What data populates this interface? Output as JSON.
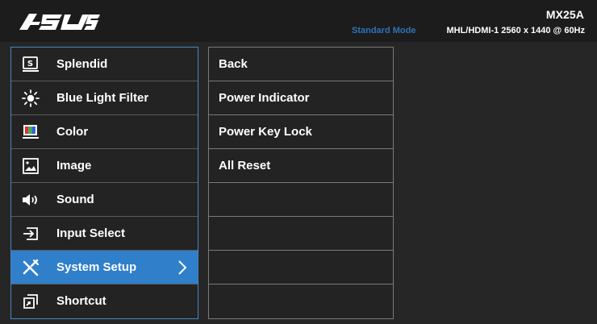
{
  "header": {
    "model": "MX25A",
    "mode": "Standard Mode",
    "input_resolution": "MHL/HDMI-1  2560 x 1440 @ 60Hz"
  },
  "sidebar": {
    "items": [
      {
        "label": "Splendid",
        "icon": "splendid-icon"
      },
      {
        "label": "Blue Light Filter",
        "icon": "blue-light-filter-icon"
      },
      {
        "label": "Color",
        "icon": "color-icon"
      },
      {
        "label": "Image",
        "icon": "image-icon"
      },
      {
        "label": "Sound",
        "icon": "sound-icon"
      },
      {
        "label": "Input Select",
        "icon": "input-select-icon"
      },
      {
        "label": "System Setup",
        "icon": "system-setup-icon",
        "active": true
      },
      {
        "label": "Shortcut",
        "icon": "shortcut-icon"
      }
    ]
  },
  "submenu": {
    "items": [
      {
        "label": "Back"
      },
      {
        "label": "Power Indicator"
      },
      {
        "label": "Power Key Lock"
      },
      {
        "label": "All Reset"
      },
      {
        "label": ""
      },
      {
        "label": ""
      },
      {
        "label": ""
      },
      {
        "label": ""
      }
    ]
  },
  "colors": {
    "accent": "#2f7fcb",
    "mode_text": "#2f73b8",
    "header_bg": "#1c1c1c",
    "panel_bg": "#232323",
    "border": "#7a7a7a"
  }
}
